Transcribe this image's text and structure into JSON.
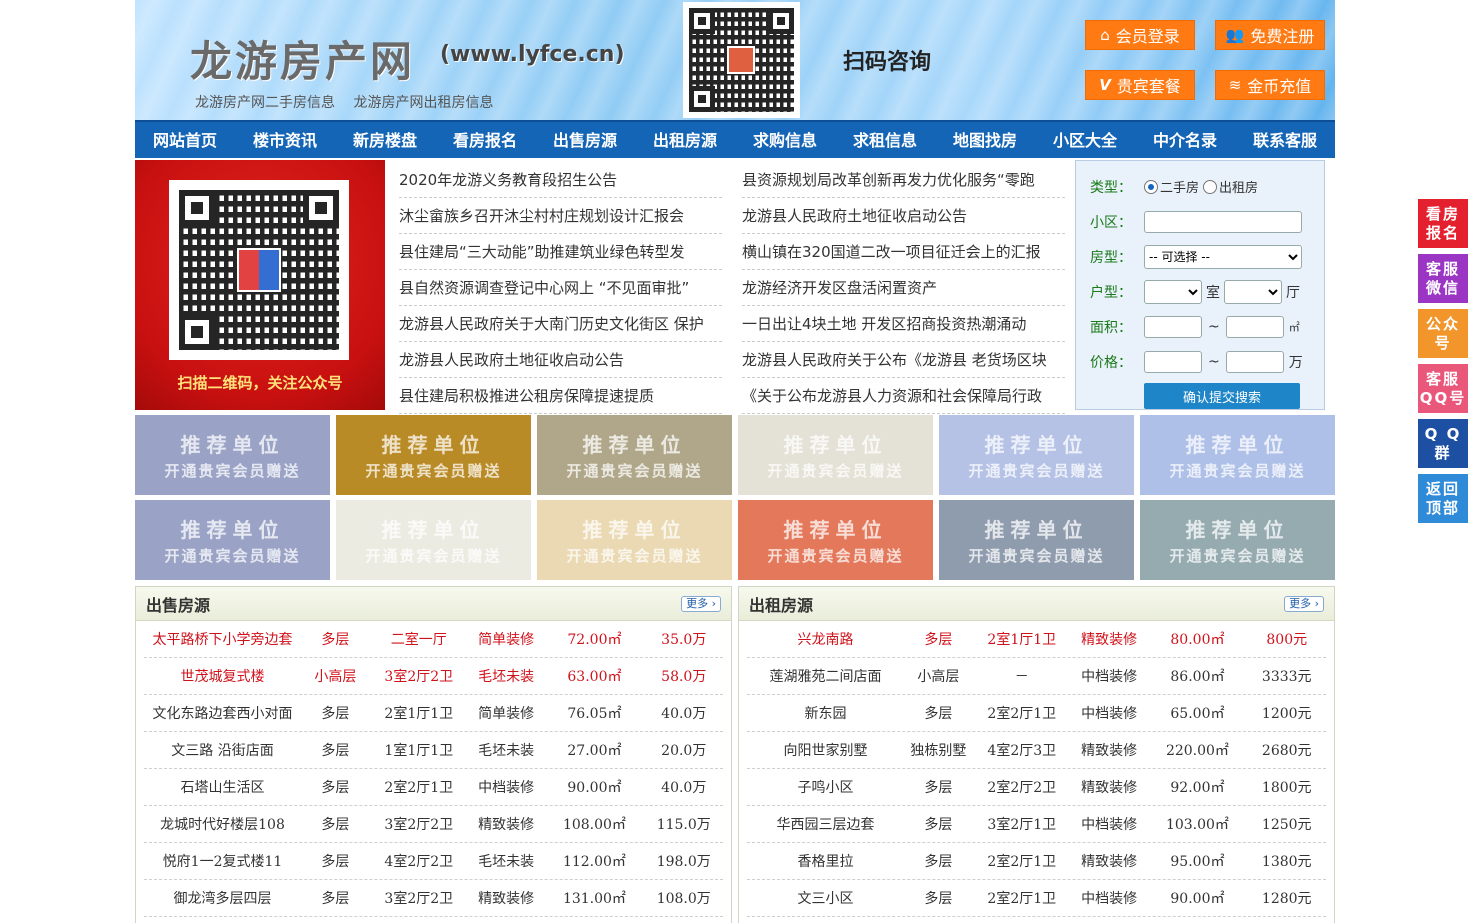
{
  "header": {
    "logo_title": "龙游房产网",
    "logo_url": "(www.lyfce.cn)",
    "sub_links": [
      "龙游房产网二手房信息",
      "龙游房产网出租房信息"
    ],
    "scan_text": "扫码咨询",
    "buttons": [
      {
        "label": "会员登录",
        "icon": "home-icon",
        "glyph": "⌂"
      },
      {
        "label": "免费注册",
        "icon": "user-add-icon",
        "glyph": "👥"
      },
      {
        "label": "贵宾套餐",
        "icon": "vip-icon",
        "glyph": "V"
      },
      {
        "label": "金币充值",
        "icon": "coins-icon",
        "glyph": "≋"
      }
    ],
    "button_color": "#ff7a12"
  },
  "nav": [
    "网站首页",
    "楼市资讯",
    "新房楼盘",
    "看房报名",
    "出售房源",
    "出租房源",
    "求购信息",
    "求租信息",
    "地图找房",
    "小区大全",
    "中介名录",
    "联系客服"
  ],
  "banner": {
    "caption": "扫描二维码，关注公众号"
  },
  "news": {
    "left": [
      "2020年龙游义务教育段招生公告",
      "沐尘畲族乡召开沐尘村村庄规划设计汇报会",
      "县住建局“三大动能”助推建筑业绿色转型发",
      "县自然资源调查登记中心网上 “不见面审批”",
      "龙游县人民政府关于大南门历史文化街区 保护",
      "龙游县人民政府土地征收启动公告",
      "县住建局积极推进公租房保障提速提质"
    ],
    "right": [
      "县资源规划局改革创新再发力优化服务“零跑",
      "龙游县人民政府土地征收启动公告",
      "横山镇在320国道二改一项目征迁会上的汇报",
      "龙游经济开发区盘活闲置资产",
      "一日出让4块土地 开发区招商投资热潮涌动",
      "龙游县人民政府关于公布《龙游县 老货场区块",
      "《关于公布龙游县人力资源和社会保障局行政"
    ]
  },
  "search": {
    "type_label": "类型：",
    "type_options": [
      "二手房",
      "出租房"
    ],
    "type_selected": "二手房",
    "community_label": "小区：",
    "community_value": "",
    "house_type_label": "房型：",
    "house_type_value": "-- 可选择 --",
    "layout_label": "户型：",
    "room_unit": "室",
    "hall_unit": "厅",
    "area_label": "面积：",
    "area_unit": "㎡",
    "price_label": "价格：",
    "price_unit": "万",
    "range_sep": "~",
    "submit": "确认提交搜索"
  },
  "ads": {
    "line1": "推荐单位",
    "line2": "开通贵宾会员赠送",
    "colors": [
      "#9aa3c6",
      "#b98b26",
      "#b0a78a",
      "#e4e1d6",
      "#b5c2e6",
      "#aec0e8",
      "#9aa3c6",
      "#ecebe2",
      "#ead9b3",
      "#e4785b",
      "#8f9cad",
      "#95abb0"
    ]
  },
  "sale": {
    "title": "出售房源",
    "more": "更多",
    "rows": [
      {
        "name": "太平路桥下小学旁边套",
        "floor": "多层",
        "layout": "二室一厅",
        "deco": "简单装修",
        "area": "72.00㎡",
        "price": "35.0万",
        "highlight": true
      },
      {
        "name": "世茂城复式楼",
        "floor": "小高层",
        "layout": "3室2厅2卫",
        "deco": "毛坯未装",
        "area": "63.00㎡",
        "price": "58.0万",
        "highlight": true
      },
      {
        "name": "文化东路边套西小对面",
        "floor": "多层",
        "layout": "2室1厅1卫",
        "deco": "简单装修",
        "area": "76.05㎡",
        "price": "40.0万",
        "highlight": false
      },
      {
        "name": "文三路 沿街店面",
        "floor": "多层",
        "layout": "1室1厅1卫",
        "deco": "毛坯未装",
        "area": "27.00㎡",
        "price": "20.0万",
        "highlight": false
      },
      {
        "name": "石塔山生活区",
        "floor": "多层",
        "layout": "2室2厅1卫",
        "deco": "中档装修",
        "area": "90.00㎡",
        "price": "40.0万",
        "highlight": false
      },
      {
        "name": "龙城时代好楼层108",
        "floor": "多层",
        "layout": "3室2厅2卫",
        "deco": "精致装修",
        "area": "108.00㎡",
        "price": "115.0万",
        "highlight": false
      },
      {
        "name": "悦府1一2复式楼11",
        "floor": "多层",
        "layout": "4室2厅2卫",
        "deco": "毛坯未装",
        "area": "112.00㎡",
        "price": "198.0万",
        "highlight": false
      },
      {
        "name": "御龙湾多层四层",
        "floor": "多层",
        "layout": "3室2厅2卫",
        "deco": "精致装修",
        "area": "131.00㎡",
        "price": "108.0万",
        "highlight": false
      }
    ]
  },
  "rent": {
    "title": "出租房源",
    "more": "更多",
    "rows": [
      {
        "name": "兴龙南路",
        "floor": "多层",
        "layout": "2室1厅1卫",
        "deco": "精致装修",
        "area": "80.00㎡",
        "price": "800元",
        "highlight": true
      },
      {
        "name": "莲湖雅苑二间店面",
        "floor": "小高层",
        "layout": "－",
        "deco": "中档装修",
        "area": "86.00㎡",
        "price": "3333元",
        "highlight": false
      },
      {
        "name": "新东园",
        "floor": "多层",
        "layout": "2室2厅1卫",
        "deco": "中档装修",
        "area": "65.00㎡",
        "price": "1200元",
        "highlight": false
      },
      {
        "name": "向阳世家别墅",
        "floor": "独栋别墅",
        "layout": "4室2厅3卫",
        "deco": "精致装修",
        "area": "220.00㎡",
        "price": "2680元",
        "highlight": false
      },
      {
        "name": "子鸣小区",
        "floor": "多层",
        "layout": "2室2厅2卫",
        "deco": "精致装修",
        "area": "92.00㎡",
        "price": "1800元",
        "highlight": false
      },
      {
        "name": "华西园三层边套",
        "floor": "多层",
        "layout": "3室2厅1卫",
        "deco": "中档装修",
        "area": "103.00㎡",
        "price": "1250元",
        "highlight": false
      },
      {
        "name": "香格里拉",
        "floor": "多层",
        "layout": "2室2厅1卫",
        "deco": "精致装修",
        "area": "95.00㎡",
        "price": "1380元",
        "highlight": false
      },
      {
        "name": "文三小区",
        "floor": "多层",
        "layout": "2室2厅1卫",
        "deco": "中档装修",
        "area": "90.00㎡",
        "price": "1280元",
        "highlight": false
      }
    ]
  },
  "float_bar": [
    {
      "l1": "看房",
      "l2": "报名",
      "color": "#e4202e",
      "name": "float-viewing-signup"
    },
    {
      "l1": "客服",
      "l2": "微信",
      "color": "#9a35c4",
      "name": "float-service-wechat"
    },
    {
      "l1": "公众",
      "l2": "号",
      "color": "#f2962c",
      "name": "float-official-account"
    },
    {
      "l1": "客服",
      "l2": "QQ号",
      "color": "#e9577b",
      "name": "float-service-qq"
    },
    {
      "l1": "Q Q",
      "l2": "群",
      "color": "#1d4fa3",
      "name": "float-qq-group"
    },
    {
      "l1": "返回",
      "l2": "顶部",
      "color": "#2f8ad8",
      "name": "float-back-to-top"
    }
  ]
}
